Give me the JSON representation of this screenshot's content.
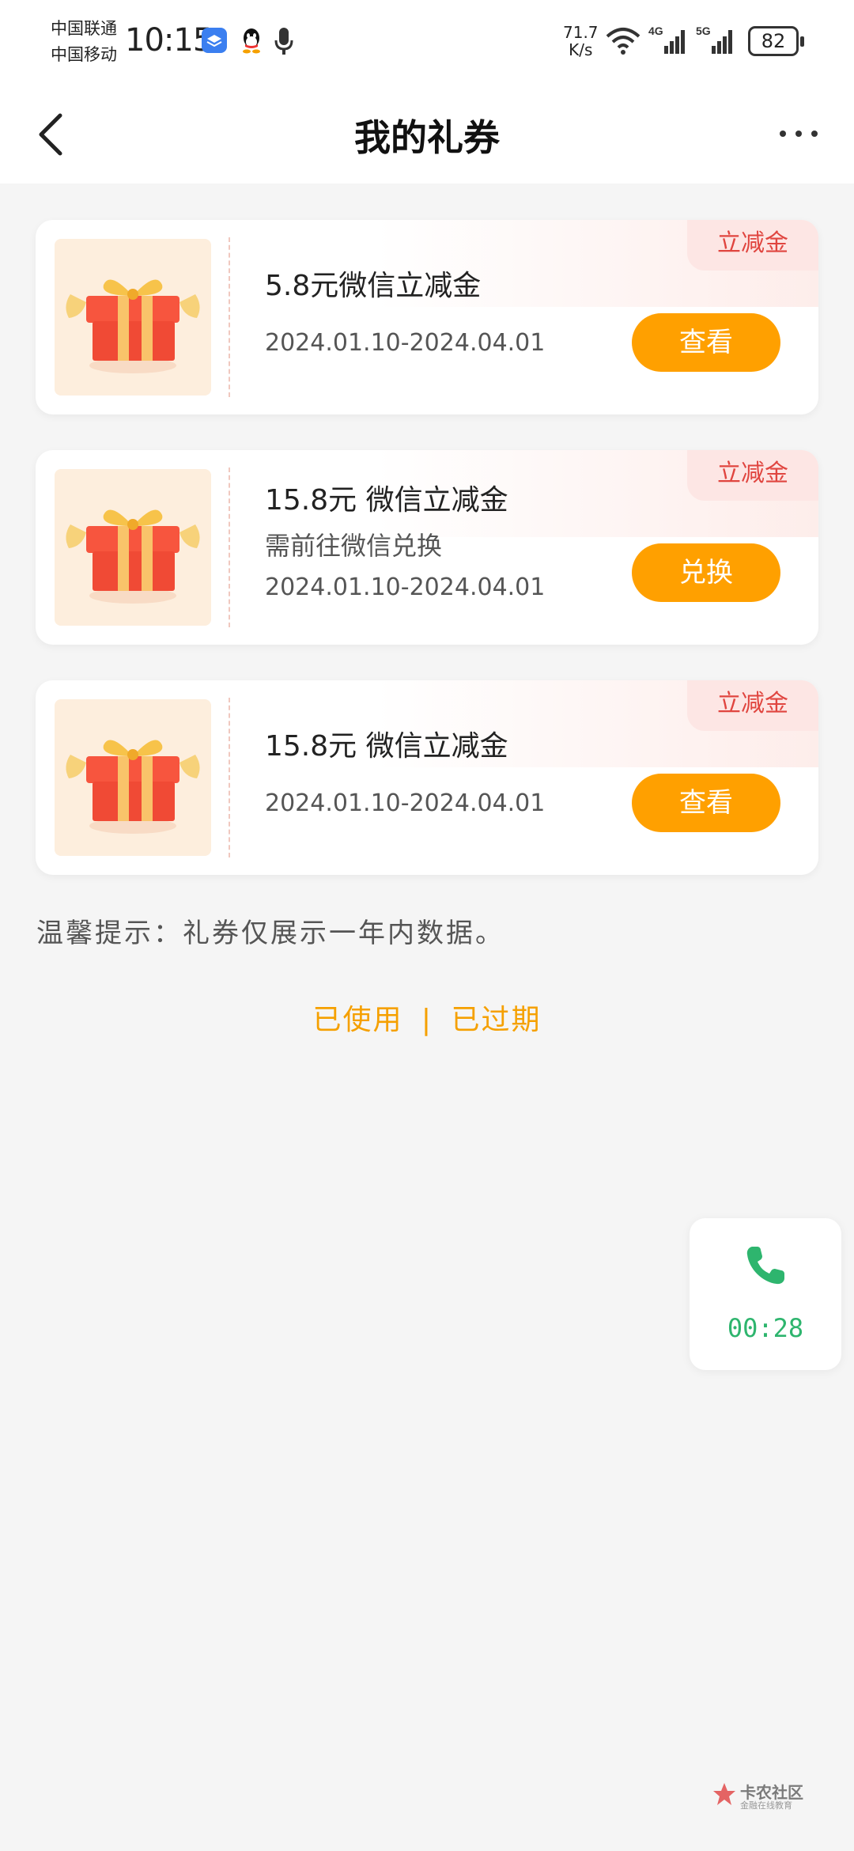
{
  "status_bar": {
    "carrier_1": "中国联通",
    "carrier_2": "中国移动",
    "time": "10:15",
    "net_speed_value": "71.7",
    "net_speed_unit": "K/s",
    "signal_1_label": "4G",
    "signal_2_label": "5G",
    "battery": "82",
    "icons": [
      "app-icon",
      "qq-icon",
      "microphone-icon",
      "wifi-icon",
      "signal-icon",
      "battery-icon"
    ]
  },
  "header": {
    "title": "我的礼券",
    "back_icon": "chevron-left-icon",
    "more_icon": "more-dots-icon"
  },
  "coupons": [
    {
      "tag": "立减金",
      "title": "5.8元微信立减金",
      "subtitle": "",
      "date_range": "2024.01.10-2024.04.01",
      "button": "查看"
    },
    {
      "tag": "立减金",
      "title": "15.8元 微信立减金",
      "subtitle": "需前往微信兑换",
      "date_range": "2024.01.10-2024.04.01",
      "button": "兑换"
    },
    {
      "tag": "立减金",
      "title": "15.8元 微信立减金",
      "subtitle": "",
      "date_range": "2024.01.10-2024.04.01",
      "button": "查看"
    }
  ],
  "tip": "温馨提示：礼券仅展示一年内数据。",
  "links": {
    "used": "已使用",
    "separator": "|",
    "expired": "已过期"
  },
  "call_widget": {
    "icon": "phone-icon",
    "duration": "00:28"
  },
  "watermark": {
    "name": "卡农社区",
    "subtitle": "金融在线教育"
  },
  "colors": {
    "accent": "#ffa000",
    "tag_text": "#e0453f",
    "tag_bg": "#fde6e4",
    "link": "#f5a000",
    "call_green": "#2eb56e",
    "background": "#f5f5f5"
  }
}
